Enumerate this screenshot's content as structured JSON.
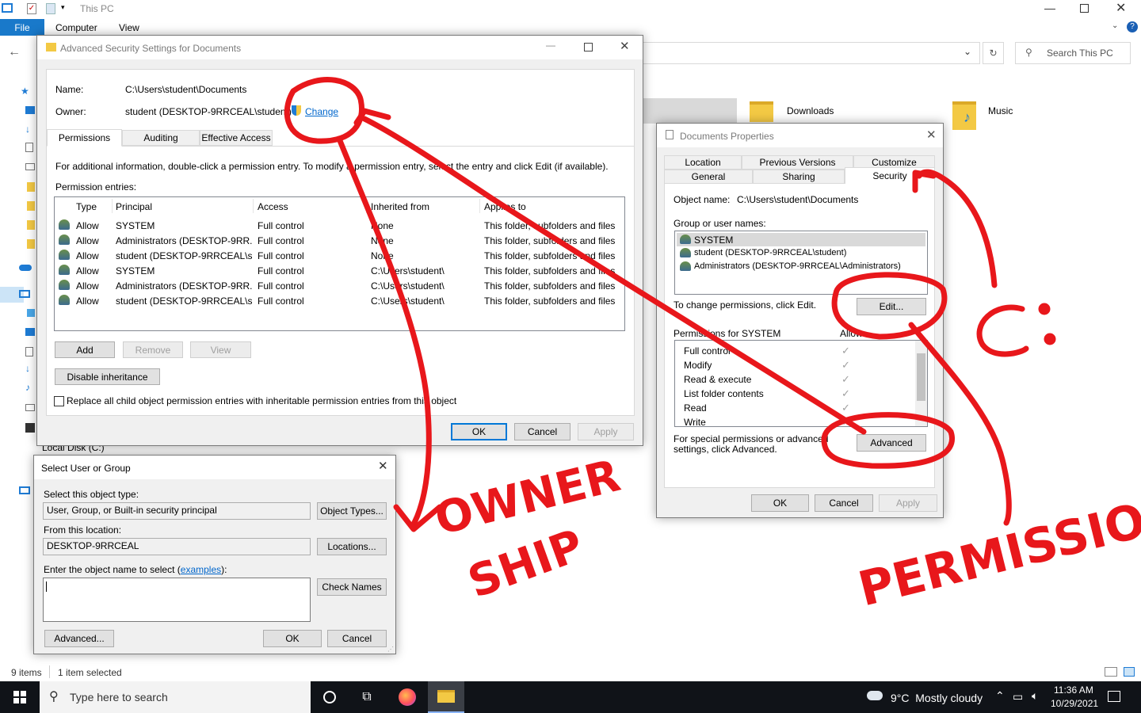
{
  "explorer": {
    "title": "This PC",
    "ribbon_tabs": [
      "File",
      "Computer",
      "View"
    ],
    "search_placeholder": "Search This PC",
    "folders": [
      "Downloads",
      "Music"
    ],
    "local_disk": "Local Disk (C:)",
    "status_items": "9 items",
    "status_selected": "1 item selected"
  },
  "adv": {
    "title": "Advanced Security Settings for Documents",
    "name_label": "Name:",
    "name_value": "C:\\Users\\student\\Documents",
    "owner_label": "Owner:",
    "owner_value": "student (DESKTOP-9RRCEAL\\student)",
    "change_link": "Change",
    "tabs": [
      "Permissions",
      "Auditing",
      "Effective Access"
    ],
    "info": "For additional information, double-click a permission entry. To modify a permission entry, select the entry and click Edit (if available).",
    "entries_label": "Permission entries:",
    "columns": [
      "Type",
      "Principal",
      "Access",
      "Inherited from",
      "Applies to"
    ],
    "rows": [
      [
        "Allow",
        "SYSTEM",
        "Full control",
        "None",
        "This folder, subfolders and files"
      ],
      [
        "Allow",
        "Administrators (DESKTOP-9RR...",
        "Full control",
        "None",
        "This folder, subfolders and files"
      ],
      [
        "Allow",
        "student (DESKTOP-9RRCEAL\\s...",
        "Full control",
        "None",
        "This folder, subfolders and files"
      ],
      [
        "Allow",
        "SYSTEM",
        "Full control",
        "C:\\Users\\student\\",
        "This folder, subfolders and files"
      ],
      [
        "Allow",
        "Administrators (DESKTOP-9RR...",
        "Full control",
        "C:\\Users\\student\\",
        "This folder, subfolders and files"
      ],
      [
        "Allow",
        "student (DESKTOP-9RRCEAL\\s...",
        "Full control",
        "C:\\Users\\student\\",
        "This folder, subfolders and files"
      ]
    ],
    "add": "Add",
    "remove": "Remove",
    "view": "View",
    "disable_inheritance": "Disable inheritance",
    "replace_label": "Replace all child object permission entries with inheritable permission entries from this object",
    "ok": "OK",
    "cancel": "Cancel",
    "apply": "Apply"
  },
  "props": {
    "title": "Documents Properties",
    "tabs_top": [
      "Location",
      "Previous Versions",
      "Customize"
    ],
    "tabs_bottom": [
      "General",
      "Sharing",
      "Security"
    ],
    "object_label": "Object name:",
    "object_value": "C:\\Users\\student\\Documents",
    "group_label": "Group or user names:",
    "groups": [
      "SYSTEM",
      "student (DESKTOP-9RRCEAL\\student)",
      "Administrators (DESKTOP-9RRCEAL\\Administrators)"
    ],
    "change_text": "To change permissions, click Edit.",
    "edit": "Edit...",
    "perm_label": "Permissions for SYSTEM",
    "allow_label": "Allow",
    "perms": [
      "Full control",
      "Modify",
      "Read & execute",
      "List folder contents",
      "Read",
      "Write"
    ],
    "special_text": "For special permissions or advanced settings, click Advanced.",
    "advanced": "Advanced",
    "ok": "OK",
    "cancel": "Cancel",
    "apply": "Apply"
  },
  "select": {
    "title": "Select User or Group",
    "type_label": "Select this object type:",
    "type_value": "User, Group, or Built-in security principal",
    "object_types": "Object Types...",
    "location_label": "From this location:",
    "location_value": "DESKTOP-9RRCEAL",
    "locations": "Locations...",
    "enter_label": "Enter the object name to select",
    "examples": "examples",
    "check_names": "Check Names",
    "advanced": "Advanced...",
    "ok": "OK",
    "cancel": "Cancel"
  },
  "annotations": {
    "ownership_line1": "OWNER",
    "ownership_line2": "SHIP",
    "permission": "PERMISSION",
    "color": "#e8171b"
  },
  "taskbar": {
    "search_placeholder": "Type here to search",
    "weather": "9°C  Mostly cloudy",
    "time": "11:36 AM",
    "date": "10/29/2021"
  }
}
